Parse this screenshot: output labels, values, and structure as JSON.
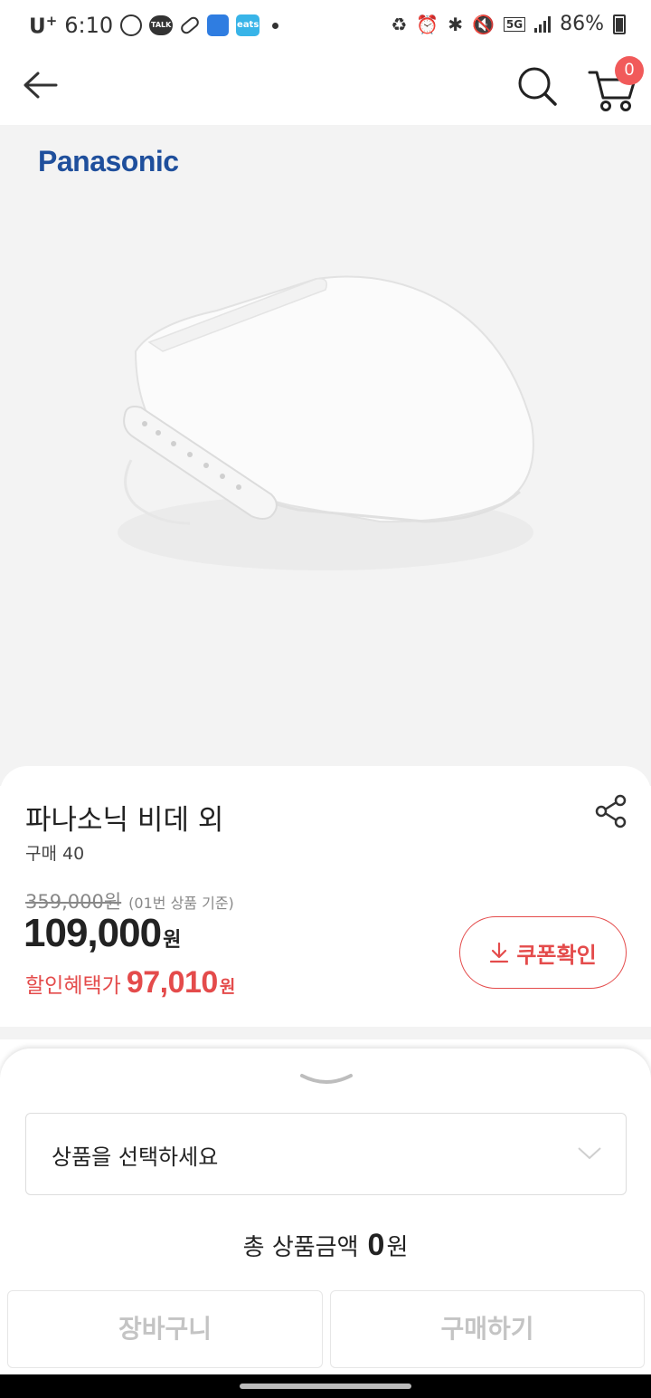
{
  "status_bar": {
    "carrier": "U",
    "carrier_sup": "+",
    "time": "6:10",
    "talk_label": "TALK",
    "app_label": "eats",
    "battery": "86%"
  },
  "cart": {
    "count": "0"
  },
  "product": {
    "brand": "Panasonic",
    "title": "파나소닉 비데 외",
    "purchase_count": "구매 40",
    "original_price": "359,000원",
    "original_note": "(01번 상품 기준)",
    "price": "109,000",
    "price_unit": "원",
    "discount_label": "할인혜택가",
    "discount_price": "97,010",
    "discount_unit": "원",
    "coupon_label": "쿠폰확인"
  },
  "sheet": {
    "option_placeholder": "상품을 선택하세요",
    "total_label": "총 상품금액",
    "total_value": "0",
    "total_unit": "원",
    "cart_button": "장바구니",
    "buy_button": "구매하기"
  },
  "colors": {
    "accent": "#e44b4b",
    "badge": "#f15a5a",
    "brand_blue": "#1f4f9c"
  }
}
